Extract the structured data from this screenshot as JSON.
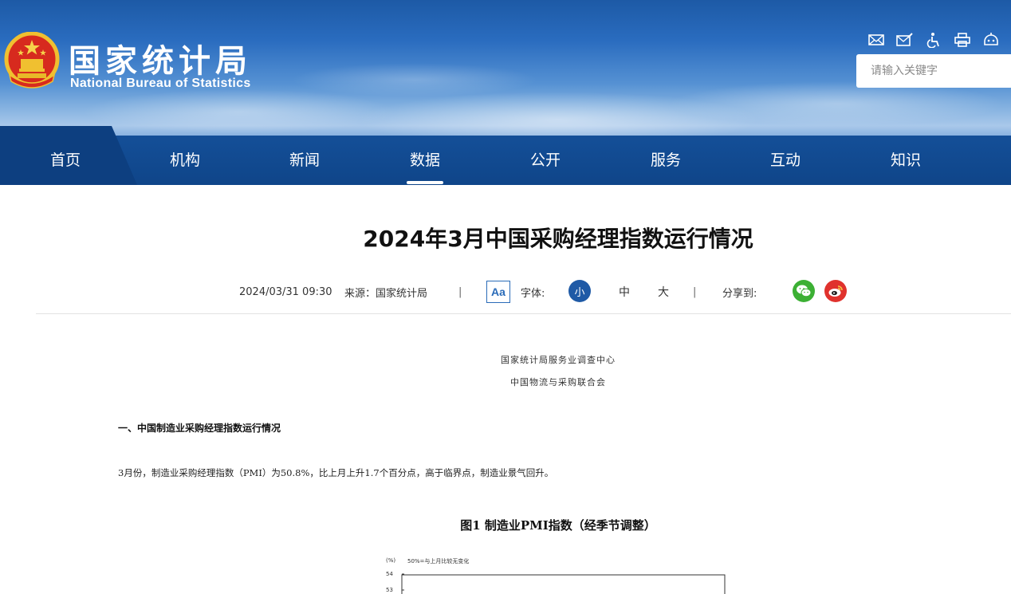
{
  "header": {
    "site_name_cn": "国家统计局",
    "site_name_en": "National Bureau of Statistics",
    "tools": [
      "mail-icon",
      "mail-edit-icon",
      "accessibility-icon",
      "print-icon",
      "robot-icon"
    ],
    "search_placeholder": "请输入关键字"
  },
  "nav": {
    "items": [
      {
        "label": "首页"
      },
      {
        "label": "机构"
      },
      {
        "label": "新闻"
      },
      {
        "label": "数据",
        "active": true
      },
      {
        "label": "公开"
      },
      {
        "label": "服务"
      },
      {
        "label": "互动"
      },
      {
        "label": "知识"
      }
    ]
  },
  "article": {
    "title": "2024年3月中国采购经理指数运行情况",
    "date": "2024/03/31 09:30",
    "source": "来源：国家统计局",
    "separator": "|",
    "font_label": "字体:",
    "font_icon": "Aa",
    "font_sizes": [
      "小",
      "中",
      "大"
    ],
    "share_label": "分享到:",
    "share_targets": [
      "wechat-icon",
      "weibo-icon"
    ],
    "org_lines": [
      "国家统计局服务业调查中心",
      "中国物流与采购联合会"
    ],
    "section_heading": "一、中国制造业采购经理指数运行情况",
    "paragraph": "3月份，制造业采购经理指数（PMI）为50.8%，比上月上升1.7个百分点，高于临界点，制造业景气回升。",
    "figure_title": "图1  制造业PMI指数（经季节调整）"
  },
  "chart_data": {
    "type": "line",
    "ylabel": "(%)",
    "note": "50%=与上月比较无变化",
    "visible_y_ticks": [
      "54",
      "53"
    ]
  },
  "colors": {
    "nav_bg": "#144f98",
    "brand_blue": "#1f5aa6",
    "wechat": "#3cb034",
    "weibo": "#e0322d"
  }
}
